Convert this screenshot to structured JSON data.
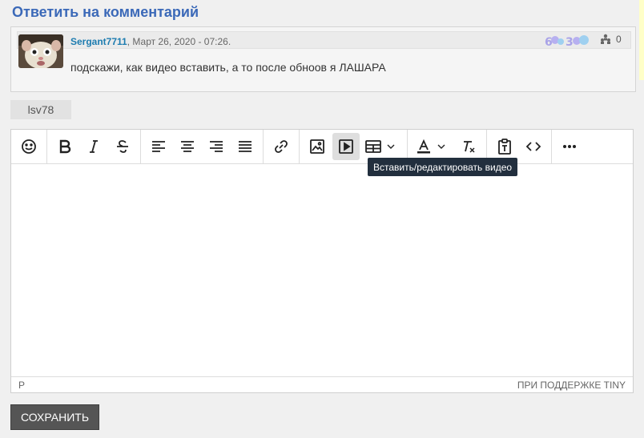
{
  "page": {
    "title": "Ответить на комментарий"
  },
  "quote": {
    "author": "Sergant7711",
    "date": ", Март 26, 2020 - 07:26.",
    "text": "подскажи, как видео вставить, а то после обноов я ЛАШАРА",
    "like_count": "0",
    "badge_text_1": "6",
    "badge_text_2": "3"
  },
  "tag": {
    "label": "lsv78"
  },
  "editor": {
    "tooltip": "Вставить/редактировать видео",
    "status_path": "P",
    "powered_by": "ПРИ ПОДДЕРЖКЕ TINY",
    "icons": [
      "emoticons-icon",
      "bold-icon",
      "italic-icon",
      "strikethrough-icon",
      "align-left-icon",
      "align-center-icon",
      "align-right-icon",
      "align-justify-icon",
      "link-icon",
      "image-icon",
      "video-icon",
      "table-icon",
      "text-color-icon",
      "remove-format-icon",
      "paste-text-icon",
      "code-icon",
      "more-icon"
    ]
  },
  "actions": {
    "save_label": "СОХРАНИТЬ"
  },
  "colors": {
    "title": "#3b69b8",
    "author": "#1d7cb0",
    "tooltip_bg": "#222f3e",
    "save_bg": "#555555"
  }
}
